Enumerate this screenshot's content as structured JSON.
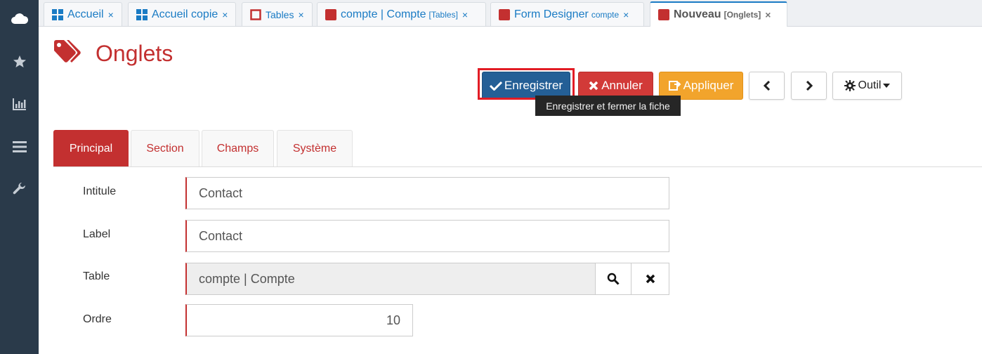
{
  "sidebar": {
    "items": [
      {
        "icon": "cloud-icon"
      },
      {
        "icon": "star-icon"
      },
      {
        "icon": "bar-chart-icon"
      },
      {
        "icon": "menu-icon"
      },
      {
        "icon": "wrench-icon"
      }
    ]
  },
  "tabs": [
    {
      "label": "Accueil",
      "sub": "",
      "icon": "windows-grid-icon"
    },
    {
      "label": "Accueil copie",
      "sub": "",
      "icon": "windows-grid-icon"
    },
    {
      "label": "Tables",
      "sub": "",
      "icon": "square-outline-icon"
    },
    {
      "label": "compte | Compte",
      "sub": "[Tables]",
      "icon": "red-square-icon"
    },
    {
      "label": "Form Designer",
      "sub": "compte",
      "icon": "red-square-icon"
    },
    {
      "label": "Nouveau",
      "sub": "[Onglets]",
      "icon": "red-square-icon"
    }
  ],
  "tab_close": "×",
  "page": {
    "title": "Onglets"
  },
  "toolbar": {
    "save_label": "Enregistrer",
    "cancel_label": "Annuler",
    "apply_label": "Appliquer",
    "tool_label": "Outil",
    "save_tooltip": "Enregistrer et fermer la fiche"
  },
  "form_tabs": [
    "Principal",
    "Section",
    "Champs",
    "Système"
  ],
  "fields": {
    "intitule": {
      "label": "Intitule",
      "value": "Contact"
    },
    "label": {
      "label": "Label",
      "value": "Contact"
    },
    "table": {
      "label": "Table",
      "value": "compte | Compte"
    },
    "ordre": {
      "label": "Ordre",
      "value": "10"
    }
  },
  "colors": {
    "accent_red": "#c33030",
    "primary_blue": "#245f96",
    "danger": "#d23a38",
    "warning": "#f2a42c",
    "sidebar": "#2a3a4a",
    "link_blue": "#1a7bc4"
  }
}
